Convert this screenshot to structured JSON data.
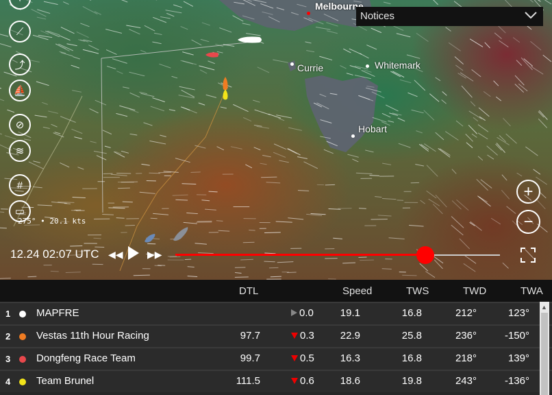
{
  "map": {
    "cities": [
      {
        "name": "Melbourne",
        "capital": true
      },
      {
        "name": "Currie"
      },
      {
        "name": "Whitemark"
      },
      {
        "name": "Hobart"
      }
    ],
    "wind_readout": "275° • 20.1 kts",
    "notices": {
      "label": "Notices"
    },
    "zoom": {
      "in_icon": "plus-icon",
      "out_icon": "minus-icon"
    },
    "left_controls": [
      "compass-icon",
      "feathers-icon",
      "route-icon",
      "boat-icon",
      "no-compass-icon",
      "wind-icon",
      "grid-icon",
      "ruler-icon"
    ]
  },
  "playback": {
    "time": "12.24 02:07 UTC",
    "progress": 0.77,
    "accent": "#ff0000"
  },
  "table": {
    "headers": {
      "dtl": "DTL",
      "speed": "Speed",
      "tws": "TWS",
      "twd": "TWD",
      "twa": "TWA"
    },
    "rows": [
      {
        "rank": "1",
        "name": "MAPFRE",
        "color": "#ffffff",
        "dtl": "",
        "delta_dir": "up",
        "delta": "0.0",
        "speed": "19.1",
        "tws": "16.8",
        "twd": "212°",
        "twa": "123°"
      },
      {
        "rank": "2",
        "name": "Vestas 11th Hour Racing",
        "color": "#f07c22",
        "dtl": "97.7",
        "delta_dir": "down",
        "delta": "0.3",
        "speed": "22.9",
        "tws": "25.8",
        "twd": "236°",
        "twa": "-150°"
      },
      {
        "rank": "3",
        "name": "Dongfeng Race Team",
        "color": "#e8484c",
        "dtl": "99.7",
        "delta_dir": "down",
        "delta": "0.5",
        "speed": "16.3",
        "tws": "16.8",
        "twd": "218°",
        "twa": "139°"
      },
      {
        "rank": "4",
        "name": "Team Brunel",
        "color": "#f2e41a",
        "dtl": "111.5",
        "delta_dir": "down",
        "delta": "0.6",
        "speed": "18.6",
        "tws": "19.8",
        "twd": "243°",
        "twa": "-136°"
      }
    ]
  }
}
